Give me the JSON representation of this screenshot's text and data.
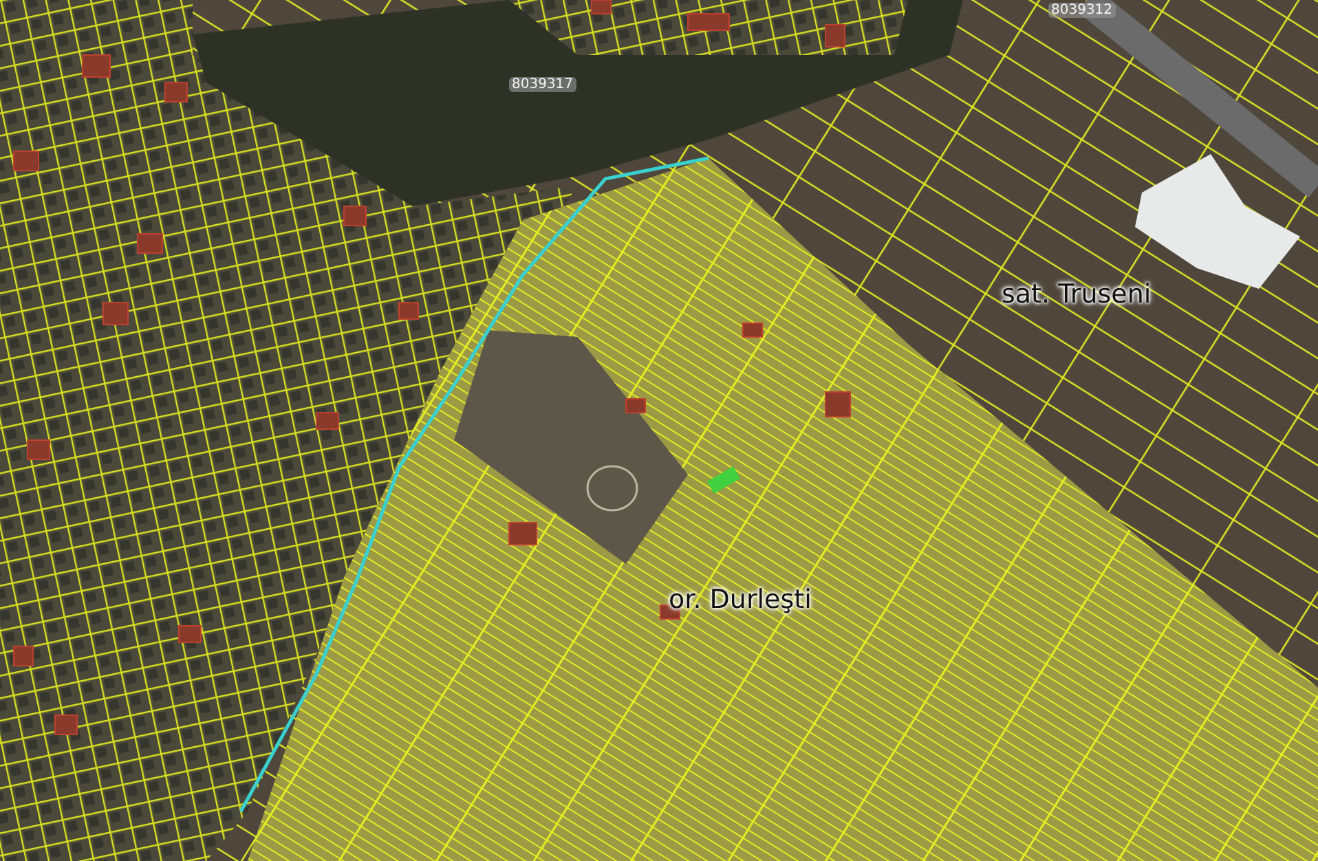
{
  "map": {
    "labels": [
      {
        "kind": "parcel",
        "text": "8039317"
      },
      {
        "kind": "parcel",
        "text": "8039312"
      },
      {
        "kind": "place",
        "text": "sat. Truseni"
      },
      {
        "kind": "place",
        "text": "or. Durleşti"
      }
    ]
  }
}
